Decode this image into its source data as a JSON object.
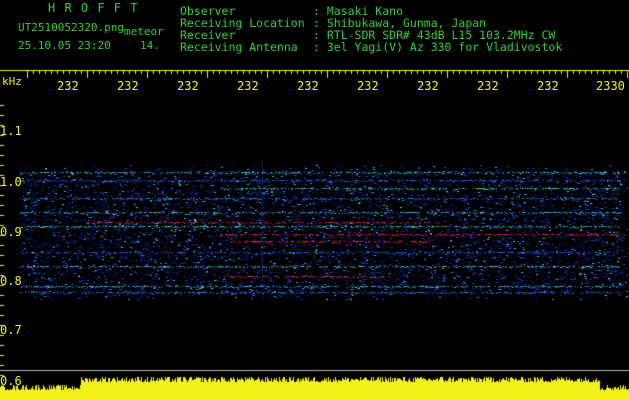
{
  "header": {
    "program": "H R O F F T",
    "filename": "UT2510052320.png",
    "mode": "meteor",
    "datetime": "25.10.05 23:20",
    "count": "14.",
    "fields": [
      {
        "label": "Observer",
        "value": ": Masaki Kano"
      },
      {
        "label": "Receiving Location",
        "value": ": Shibukawa, Gunma, Japan"
      },
      {
        "label": "Receiver",
        "value": ": RTL-SDR SDR# 43dB L15 103.2MHz CW"
      },
      {
        "label": "Receiving Antenna",
        "value": ": 3el Yagi(V) Az 330 for Vladivostok"
      }
    ]
  },
  "axis": {
    "unit": "kHz",
    "y_ticks": [
      "1.1",
      "1.0",
      "0.9",
      "0.8",
      "0.7",
      "0.6"
    ],
    "x_ticks": [
      "232",
      "232",
      "232",
      "232",
      "232",
      "232",
      "232",
      "232",
      "232",
      "2330"
    ]
  },
  "colors": {
    "background": "#000000",
    "header_green": "#2fd22f",
    "axis_yellow": "#f2f21a",
    "signal_red": "#ff2040",
    "noise_blue": "#1030c0"
  }
}
